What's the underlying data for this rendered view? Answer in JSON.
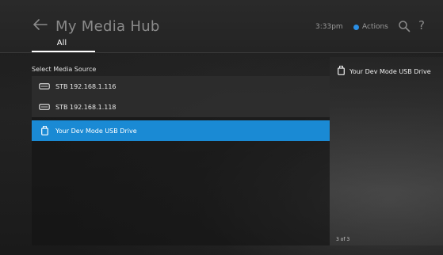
{
  "header": {
    "title": "My Media Hub",
    "time": "3:33pm",
    "actions_label": "Actions",
    "accent_color": "#2a8fe6"
  },
  "tabs": [
    {
      "label": "All",
      "selected": true
    }
  ],
  "media_source": {
    "label": "Select Media Source",
    "items": [
      {
        "label": "STB 192.168.1.116",
        "icon": "hard-drive-icon",
        "selected": false
      },
      {
        "label": "STB 192.168.1.118",
        "icon": "hard-drive-icon",
        "selected": false
      },
      {
        "label": "Your Dev Mode USB Drive",
        "icon": "usb-drive-icon",
        "selected": true
      }
    ],
    "selected_color": "#1a8ad4"
  },
  "detail": {
    "title": "Your Dev Mode USB Drive",
    "icon": "usb-drive-icon",
    "counter": "3 of 3"
  }
}
